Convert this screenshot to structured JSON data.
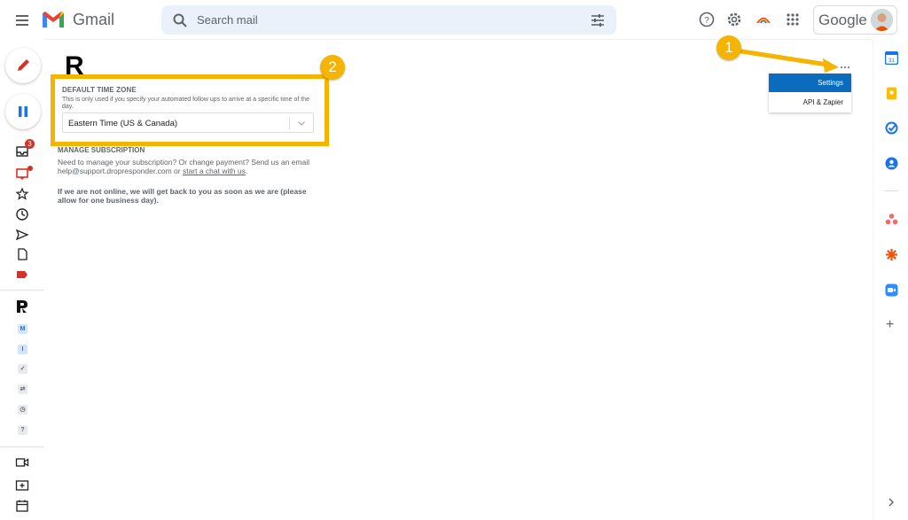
{
  "app": {
    "title": "Gmail",
    "brand": "Google"
  },
  "search": {
    "placeholder": "Search mail"
  },
  "left_rail": {
    "inbox_badge": "3",
    "addon_squares": [
      {
        "letter": "M",
        "color": "#1a73e8",
        "bg": "#d2e3fc"
      },
      {
        "letter": "I",
        "color": "#1a73e8",
        "bg": "#d2e3fc"
      },
      {
        "letter": "✓",
        "color": "#5f6368",
        "bg": "#e8eaed"
      },
      {
        "letter": "⇄",
        "color": "#5f6368",
        "bg": "#e8eaed"
      },
      {
        "letter": "◷",
        "color": "#5f6368",
        "bg": "#e8eaed"
      },
      {
        "letter": "?",
        "color": "#5f6368",
        "bg": "#e8eaed"
      }
    ]
  },
  "main": {
    "big_letter": "R",
    "timezone": {
      "title": "DEFAULT TIME ZONE",
      "help": "This is only used if you specify your automated follow ups to arrive at a specific time of the day.",
      "selected": "Eastern Time (US & Canada)"
    },
    "subscription": {
      "title": "MANAGE SUBSCRIPTION",
      "text": "Need to manage your subscription? Or change payment? Send us an email help@support.dropresponder.com or",
      "link": "start a chat with us",
      "after_link": "."
    },
    "offline_note": "If we are not online, we will get back to you as soon as we are (please allow for one business day)."
  },
  "menu": {
    "settings_label": "Settings",
    "api_label": "API & Zapier"
  },
  "callouts": {
    "one": "1",
    "two": "2"
  },
  "colors": {
    "callout": "#f4b400",
    "menu_active": "#0b6bbf",
    "badge": "#d93025"
  }
}
